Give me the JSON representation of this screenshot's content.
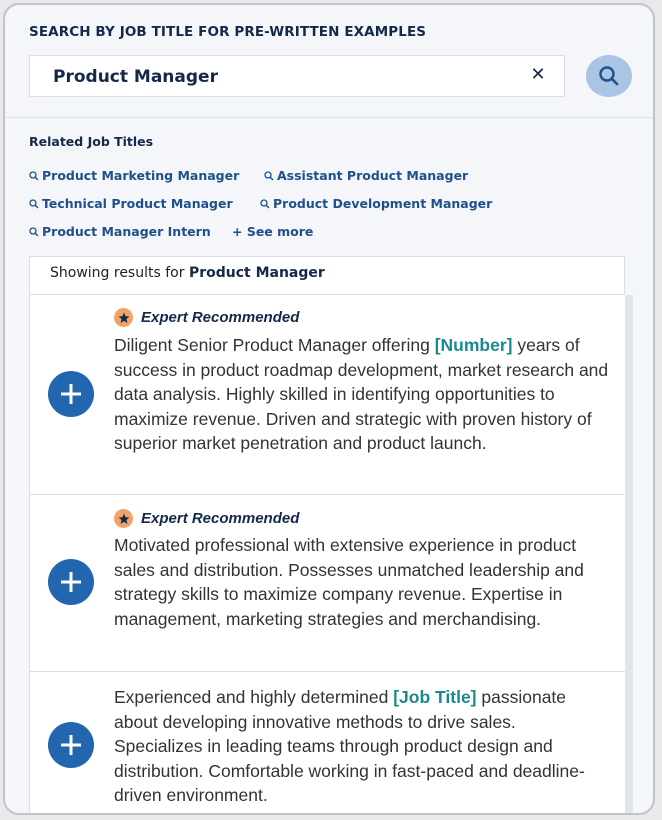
{
  "header": {
    "title": "SEARCH BY JOB TITLE FOR PRE-WRITTEN EXAMPLES"
  },
  "search": {
    "value": "Product Manager",
    "clear_icon": "close-icon",
    "search_icon": "search-icon"
  },
  "related": {
    "label": "Related Job Titles",
    "links": [
      "Product Marketing Manager",
      "Assistant Product Manager",
      "Technical Product Manager",
      "Product Development Manager",
      "Product Manager Intern"
    ],
    "see_more": "+ See more"
  },
  "showing": {
    "prefix": "Showing results for ",
    "query": "Product Manager"
  },
  "results": [
    {
      "badge": "Expert Recommended",
      "text_before": "Diligent Senior Product Manager offering ",
      "placeholder": "[Number]",
      "text_after": " years of success in product roadmap development, market research and data analysis. Highly skilled in identifying opportunities to maximize revenue. Driven and strategic with proven history of superior market penetration and product launch."
    },
    {
      "badge": "Expert Recommended",
      "text_before": "Motivated professional with extensive experience in product sales and distribution. Possesses unmatched leadership and strategy skills to maximize company revenue. Expertise in management, marketing strategies and merchandising."
    },
    {
      "text_before": "Experienced and highly determined ",
      "placeholder": "[Job Title]",
      "text_after": " passionate about developing innovative methods to drive sales. Specializes in leading teams through product design and distribution. Comfortable working in fast-paced and deadline-driven environment."
    }
  ],
  "colors": {
    "accent": "#2166ae",
    "badge": "#f0a36b",
    "highlight": "#1a8a90",
    "navy": "#14294a"
  }
}
